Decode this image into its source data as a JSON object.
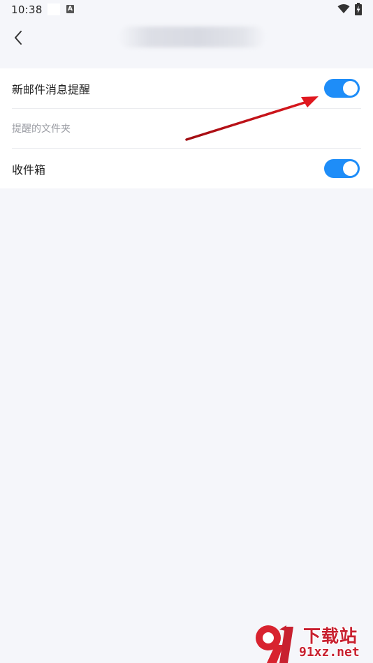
{
  "status_bar": {
    "time": "10:38",
    "input_indicator": "A",
    "icons": [
      "notification-square-icon",
      "keyboard-a-icon",
      "wifi-icon",
      "battery-charging-icon"
    ]
  },
  "nav": {
    "back_icon": "chevron-left-icon",
    "title": ""
  },
  "settings": {
    "new_mail_label": "新邮件消息提醒",
    "new_mail_enabled": true,
    "folders_section_label": "提醒的文件夹",
    "inbox_label": "收件箱",
    "inbox_enabled": true
  },
  "colors": {
    "accent": "#1e8df8",
    "background": "#f5f6fa",
    "annotation_arrow": "#d0141b",
    "watermark": "#c8202f"
  },
  "watermark": {
    "title": "下载站",
    "url": "91xz.net"
  }
}
